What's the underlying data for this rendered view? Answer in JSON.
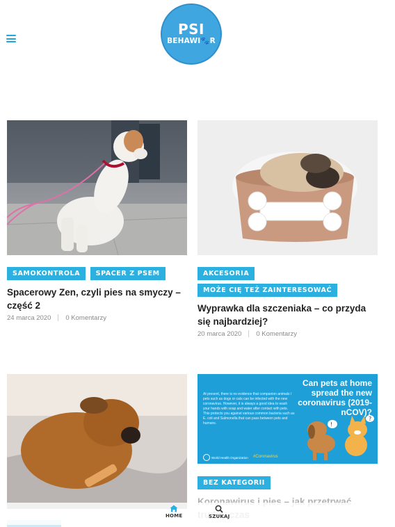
{
  "header": {
    "logo_line1": "PSI",
    "logo_line2": "BEHAWI🐾R"
  },
  "posts": [
    {
      "badges": [
        "SAMOKONTROLA",
        "SPACER Z PSEM"
      ],
      "title": "Spacerowy Zen, czyli pies na smyczy – część 2",
      "date": "24 marca 2020",
      "comments": "0 Komentarzy"
    },
    {
      "badges": [
        "AKCESORIA",
        "MOŻE CIĘ TEŻ ZAINTERESOWAĆ"
      ],
      "title": "Wyprawka dla szczeniaka – co przyda się najbardziej?",
      "date": "20 marca 2020",
      "comments": "0 Komentarzy"
    },
    {
      "badges": [],
      "title": "",
      "date": "",
      "comments": ""
    },
    {
      "badges": [
        "BEZ KATEGORII"
      ],
      "title": "Koronawirus i pies – jak przetrwać trudny czas",
      "date": "",
      "comments": ""
    }
  ],
  "infographic": {
    "heading": "Can pets at home spread the new coronavirus (2019-nCOV)?",
    "body": "At present, there is no evidence that companion animals / pets such as dogs or cats can be infected with the new coronavirus. However, it is always a good idea to wash your hands with soap and water after contact with pets. This protects you against various common bacteria such as E. coli and Salmonella that can pass between pets and humans.",
    "org": "World Health Organization",
    "hashtag": "#Coronavirus"
  },
  "bottom_nav": {
    "home": "HOME",
    "search": "SZUKAJ"
  },
  "colors": {
    "accent": "#2bb0e0",
    "logo": "#3fa6df"
  }
}
